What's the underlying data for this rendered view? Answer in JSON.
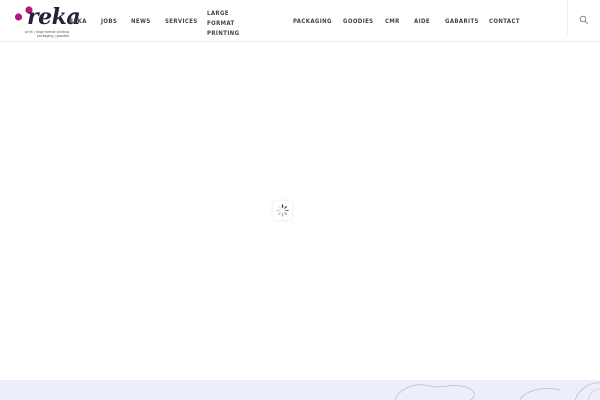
{
  "brand": {
    "name": "reka",
    "tagline_line1": "print | large format printing",
    "tagline_line2": "packaging | goodies",
    "accent_color": "#b5177d",
    "text_color": "#2a1f3a"
  },
  "nav": {
    "items": [
      {
        "label": "REKA"
      },
      {
        "label": "JOBS"
      },
      {
        "label": "NEWS"
      },
      {
        "label": "SERVICES"
      },
      {
        "label": "LARGE FORMAT PRINTING"
      },
      {
        "label": "PACKAGING"
      },
      {
        "label": "GOODIES"
      },
      {
        "label": "CMR"
      },
      {
        "label": "AIDE"
      },
      {
        "label": "GABARITS"
      },
      {
        "label": "CONTACT"
      }
    ]
  },
  "search": {
    "icon": "search-icon"
  },
  "loader": {
    "icon": "spinner-icon"
  },
  "footer": {
    "band_color": "#eceef9",
    "decoration_color": "#c9b6da"
  }
}
